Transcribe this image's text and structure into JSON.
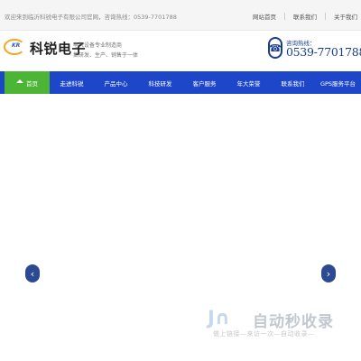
{
  "topbar": {
    "welcome": "欢迎来到临沂科锐电子有限公司官网，咨询热线：0539-7701788",
    "links": [
      "网站首页",
      "联系我们",
      "关于我们"
    ]
  },
  "logo": {
    "mark": "KR",
    "name": "科锐电子"
  },
  "tagline": {
    "line1": "电气设备专业制造商",
    "line2": "集研发、生产、销售于一体"
  },
  "hotline": {
    "label": "咨询热线：",
    "number": "0539-7701788"
  },
  "nav": {
    "items": [
      {
        "label": "首页",
        "active": true
      },
      {
        "label": "走进科锐",
        "active": false
      },
      {
        "label": "产品中心",
        "active": false
      },
      {
        "label": "科技研发",
        "active": false
      },
      {
        "label": "客户服务",
        "active": false
      },
      {
        "label": "年大荣誉",
        "active": false
      },
      {
        "label": "联系我们",
        "active": false
      },
      {
        "label": "GPS服务平台",
        "active": false
      }
    ],
    "colors": {
      "bar": "#1d47c8",
      "active": "#4cb535"
    }
  },
  "banner": {
    "prev_icon": "chevron-left-icon",
    "next_icon": "chevron-right-icon"
  },
  "watermark": {
    "title": "自动秒收录",
    "subtitle": "做上链接—来访一次—自动收录—"
  }
}
